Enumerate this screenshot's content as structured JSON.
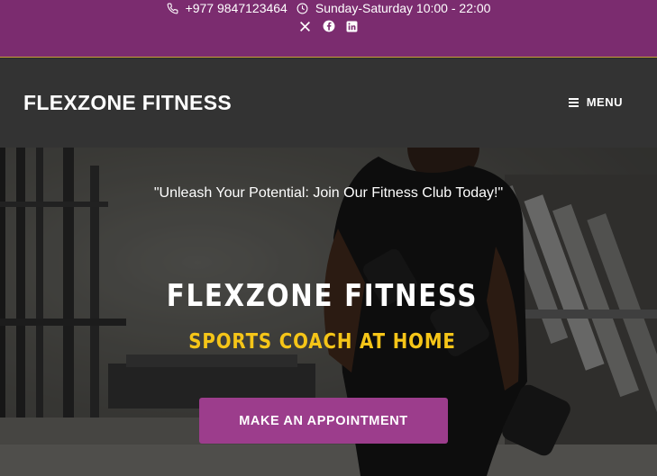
{
  "topbar": {
    "phone": "+977 9847123464",
    "hours": "Sunday-Saturday 10:00 - 22:00",
    "phone_icon": "phone-icon",
    "hours_icon": "clock-icon",
    "social": [
      "x-icon",
      "facebook-icon",
      "linkedin-icon"
    ],
    "background": "#7b2c6f"
  },
  "header": {
    "brand": "FLEXZONE FITNESS",
    "menu_label": "MENU",
    "background": "#333333"
  },
  "hero": {
    "tagline": "\"Unleash Your Potential: Join Our Fitness Club Today!\"",
    "title": "FLEXZONE FITNESS",
    "subtitle": "SPORTS COACH AT HOME",
    "cta_label": "MAKE AN APPOINTMENT",
    "subtitle_color": "#f5c518",
    "cta_color": "#9c3d8c"
  }
}
